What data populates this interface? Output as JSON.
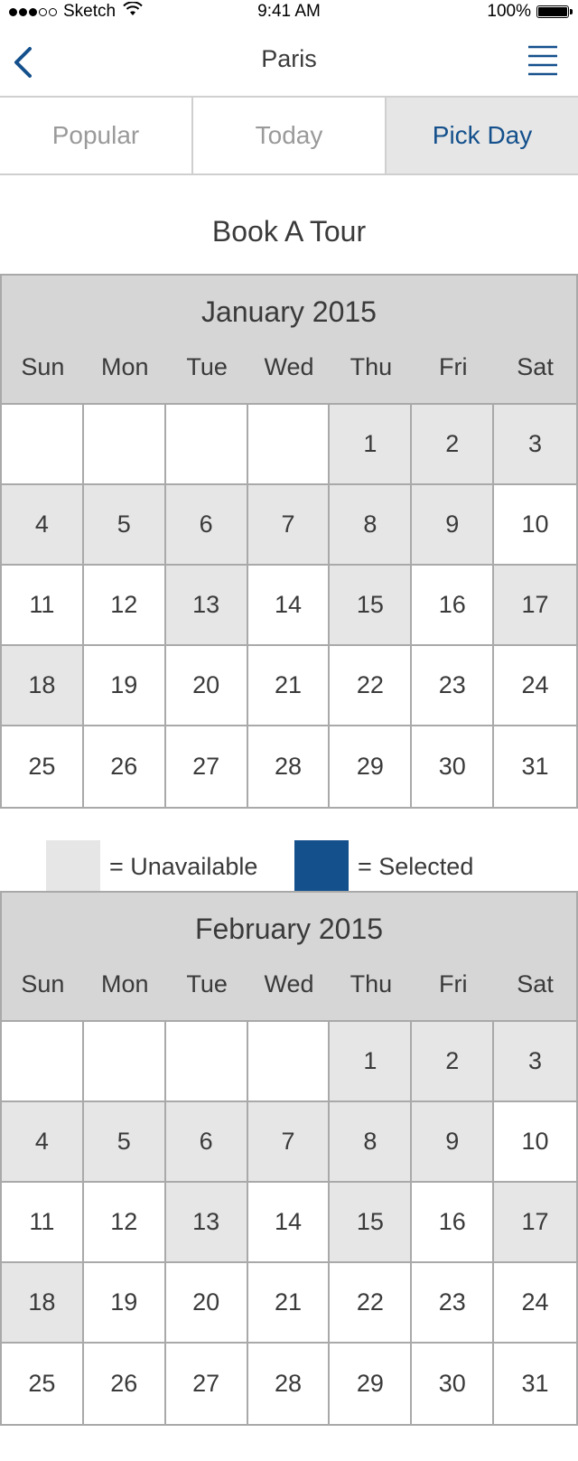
{
  "status_bar": {
    "carrier": "Sketch",
    "time": "9:41 AM",
    "battery": "100%"
  },
  "nav": {
    "title": "Paris",
    "back_icon": "chevron-left-icon",
    "menu_icon": "hamburger-menu-icon"
  },
  "tabs": [
    {
      "label": "Popular",
      "active": false
    },
    {
      "label": "Today",
      "active": false
    },
    {
      "label": "Pick Day",
      "active": true
    }
  ],
  "page_title": "Book A Tour",
  "colors": {
    "accent": "#14508c",
    "unavailable": "#e6e6e6",
    "header": "#d6d6d6"
  },
  "weekdays": [
    "Sun",
    "Mon",
    "Tue",
    "Wed",
    "Thu",
    "Fri",
    "Sat"
  ],
  "calendars": [
    {
      "month": "January 2015",
      "weeks": [
        [
          null,
          null,
          null,
          null,
          1,
          2,
          3
        ],
        [
          4,
          5,
          6,
          7,
          8,
          9,
          10
        ],
        [
          11,
          12,
          13,
          14,
          15,
          16,
          17
        ],
        [
          18,
          19,
          20,
          21,
          22,
          23,
          24
        ],
        [
          25,
          26,
          27,
          28,
          29,
          30,
          31
        ]
      ],
      "unavailable": [
        1,
        2,
        3,
        4,
        5,
        6,
        7,
        8,
        9,
        13,
        15,
        17,
        18
      ]
    },
    {
      "month": "February 2015",
      "weeks": [
        [
          null,
          null,
          null,
          null,
          1,
          2,
          3
        ],
        [
          4,
          5,
          6,
          7,
          8,
          9,
          10
        ],
        [
          11,
          12,
          13,
          14,
          15,
          16,
          17
        ],
        [
          18,
          19,
          20,
          21,
          22,
          23,
          24
        ],
        [
          25,
          26,
          27,
          28,
          29,
          30,
          31
        ]
      ],
      "unavailable": [
        1,
        2,
        3,
        4,
        5,
        6,
        7,
        8,
        9,
        13,
        15,
        17,
        18
      ]
    }
  ],
  "legend": {
    "unavailable_label": "= Unavailable",
    "selected_label": "= Selected"
  }
}
